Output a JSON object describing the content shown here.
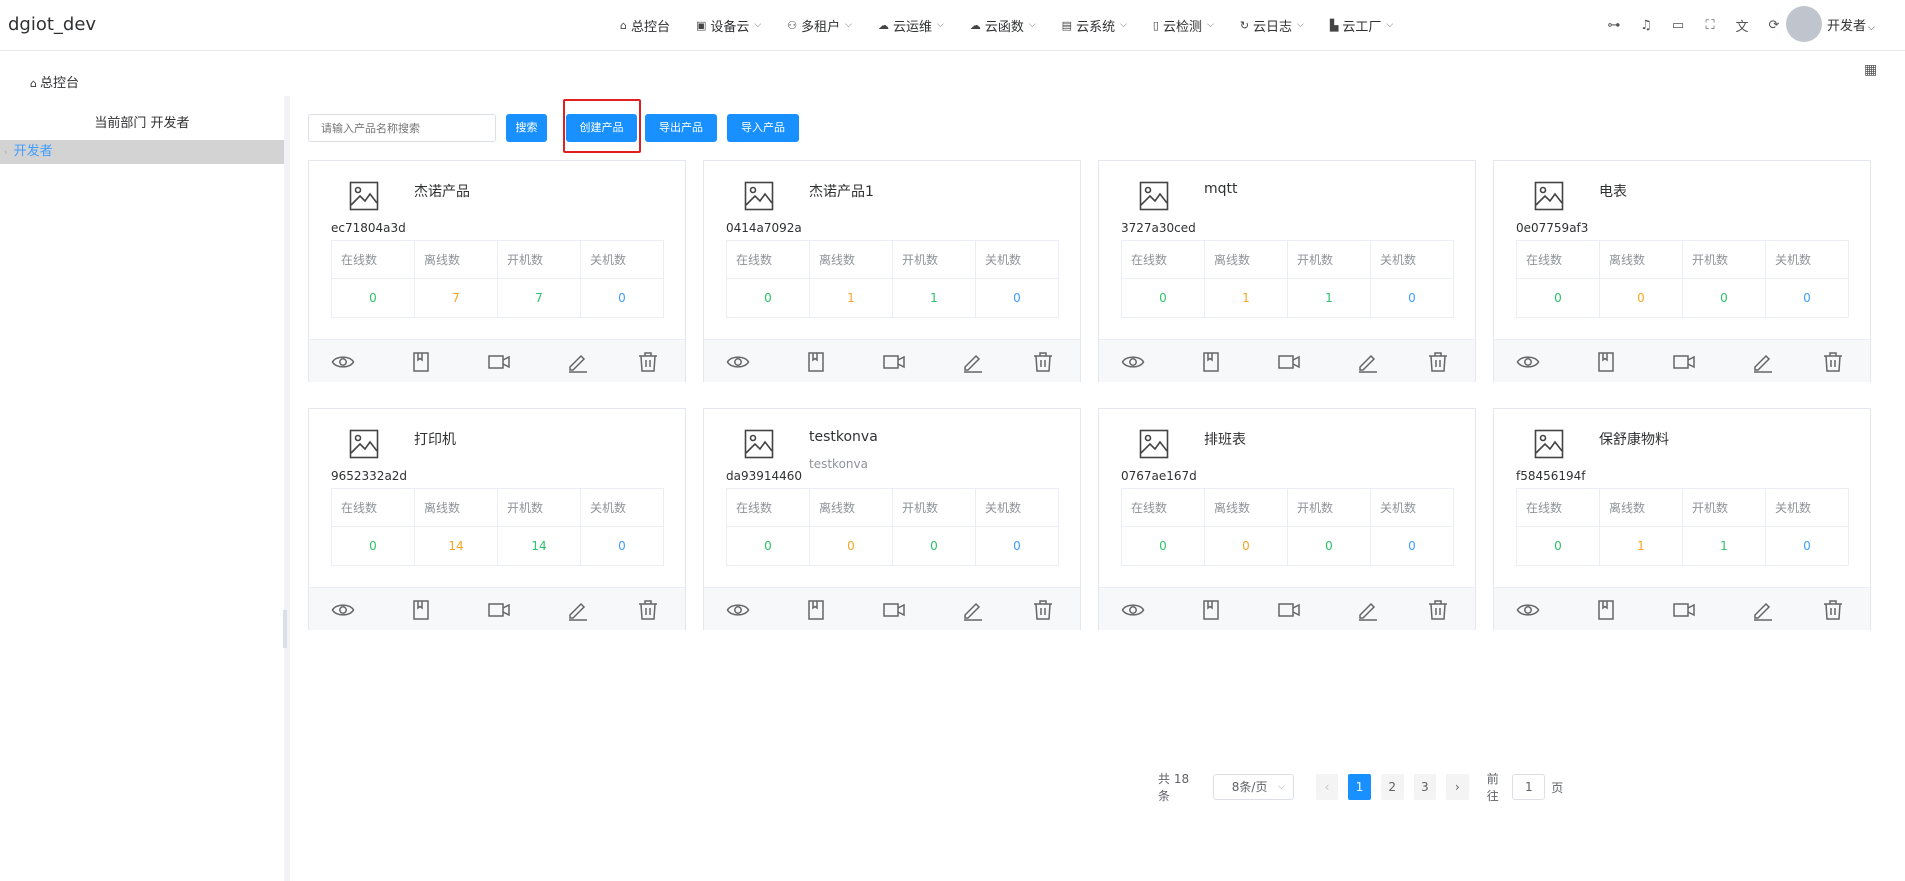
{
  "app": {
    "title": "dgiot_dev"
  },
  "nav": [
    {
      "label": "总控台",
      "icon": "home-icon",
      "has_menu": false
    },
    {
      "label": "设备云",
      "icon": "device-icon",
      "has_menu": true
    },
    {
      "label": "多租户",
      "icon": "users-icon",
      "has_menu": true
    },
    {
      "label": "云运维",
      "icon": "cloud-icon",
      "has_menu": true
    },
    {
      "label": "云函数",
      "icon": "function-icon",
      "has_menu": true
    },
    {
      "label": "云系统",
      "icon": "system-icon",
      "has_menu": true
    },
    {
      "label": "云检测",
      "icon": "test-icon",
      "has_menu": true
    },
    {
      "label": "云日志",
      "icon": "log-icon",
      "has_menu": true
    },
    {
      "label": "云工厂",
      "icon": "factory-icon",
      "has_menu": true
    }
  ],
  "user": {
    "name": "开发者"
  },
  "tags": {
    "home": "总控台"
  },
  "sidebar": {
    "title": "当前部门 开发者",
    "tree_item": "开发者"
  },
  "toolbar": {
    "search_placeholder": "请输入产品名称搜索",
    "search_label": "搜索",
    "create_label": "创建产品",
    "export_label": "导出产品",
    "import_label": "导入产品"
  },
  "stat_headers": [
    "在线数",
    "离线数",
    "开机数",
    "关机数"
  ],
  "products": [
    {
      "name": "杰诺产品",
      "sub": "",
      "id": "ec71804a3d",
      "online": "0",
      "offline": "7",
      "on": "7",
      "off": "0"
    },
    {
      "name": "杰诺产品1",
      "sub": "",
      "id": "0414a7092a",
      "online": "0",
      "offline": "1",
      "on": "1",
      "off": "0"
    },
    {
      "name": "mqtt",
      "sub": "",
      "id": "3727a30ced",
      "online": "0",
      "offline": "1",
      "on": "1",
      "off": "0"
    },
    {
      "name": "电表",
      "sub": "",
      "id": "0e07759af3",
      "online": "0",
      "offline": "0",
      "on": "0",
      "off": "0"
    },
    {
      "name": "打印机",
      "sub": "",
      "id": "9652332a2d",
      "online": "0",
      "offline": "14",
      "on": "14",
      "off": "0"
    },
    {
      "name": "testkonva",
      "sub": "testkonva",
      "id": "da93914460",
      "online": "0",
      "offline": "0",
      "on": "0",
      "off": "0"
    },
    {
      "name": "排班表",
      "sub": "",
      "id": "0767ae167d",
      "online": "0",
      "offline": "0",
      "on": "0",
      "off": "0"
    },
    {
      "name": "保舒康物料",
      "sub": "",
      "id": "f58456194f",
      "online": "0",
      "offline": "1",
      "on": "1",
      "off": "0"
    }
  ],
  "pagination": {
    "total": "共 18 条",
    "page_size": "8条/页",
    "pages": [
      "1",
      "2",
      "3"
    ],
    "current": "1",
    "goto_prefix": "前往",
    "goto_value": "1",
    "goto_suffix": "页"
  },
  "colors": {
    "primary": "#1890ff",
    "online": "#2dc26b",
    "offline": "#f5a623",
    "off": "#409eff",
    "highlight": "#e02020"
  }
}
